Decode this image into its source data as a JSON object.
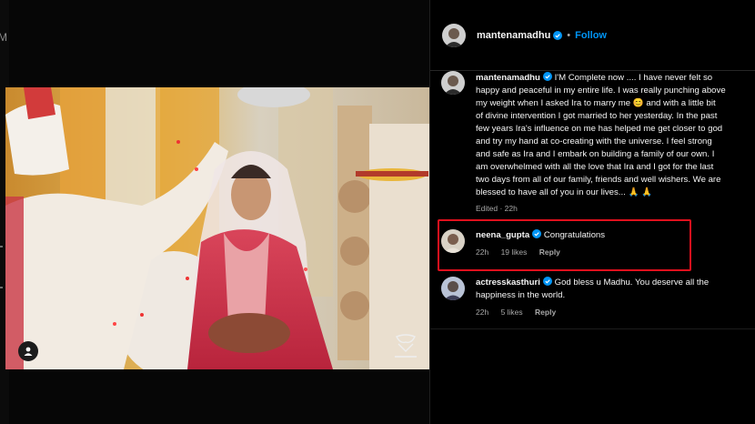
{
  "edge": {
    "letter": "M"
  },
  "post_author": {
    "username": "mantenamadhu",
    "follow_label": "Follow",
    "separator": "•"
  },
  "caption": {
    "username": "mantenamadhu",
    "text": "I'M Complete now .... I have never felt so\nhappy and peaceful in my entire life. I was really punching above\nmy weight when I asked Ira to marry me 😊 and with a little bit\nof divine intervention I got married to her yesterday. In the past\nfew years Ira's influence on me has helped me get closer to god\nand try my hand at co-creating with the universe. I feel strong\nand safe as Ira and I embark on building a family of our own. I\nam overwhelmed with all the love that Ira and I got for the last\ntwo days from all of our family, friends and well wishers. We are\nblessed to have all of you in our lives... 🙏 🙏",
    "edited": "Edited · 22h"
  },
  "comments": [
    {
      "username": "neena_gupta",
      "text": "Congratulations",
      "time": "22h",
      "likes": "19 likes",
      "reply": "Reply",
      "highlighted": true
    },
    {
      "username": "actresskasthuri",
      "text": "God bless u Madhu. You deserve all the\nhappiness in the world.",
      "time": "22h",
      "likes": "5 likes",
      "reply": "Reply",
      "highlighted": false
    }
  ],
  "colors": {
    "accent": "#0095f6",
    "highlight_box": "#e0101d",
    "background": "#000000"
  },
  "icons": {
    "verified": "verified-badge-icon",
    "tag": "user-tag-icon"
  }
}
